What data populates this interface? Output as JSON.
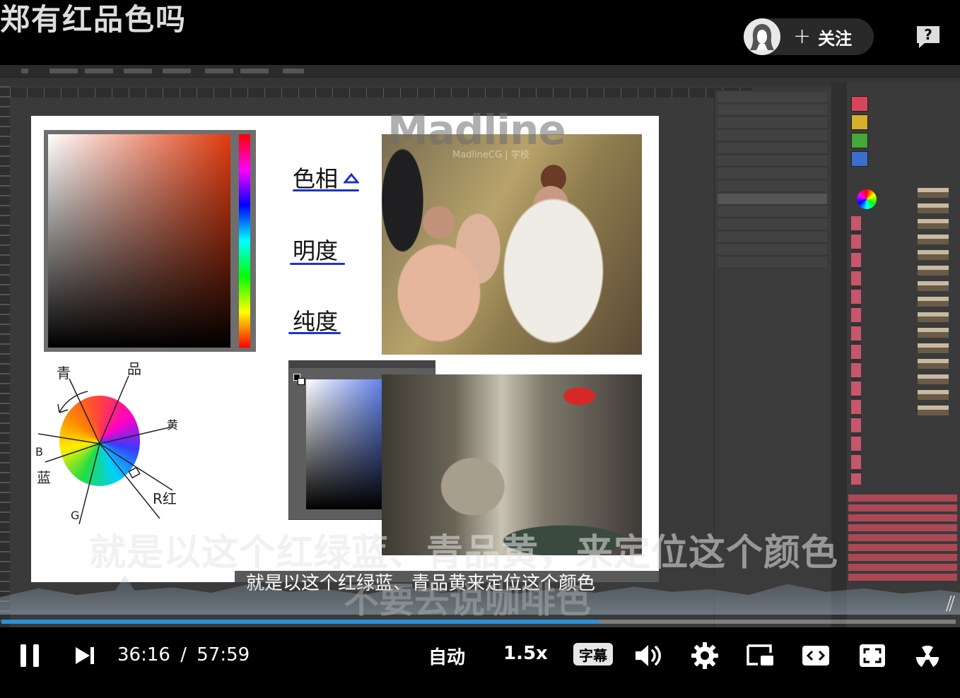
{
  "header": {
    "title": "郑有红品色吗",
    "follow_label": "关注",
    "follow_plus": "+"
  },
  "video": {
    "canvas": {
      "label_hue": "色相",
      "label_brightness": "明度",
      "label_saturation": "纯度",
      "logo": "Madline",
      "logo_sub": "MadlineCG | 学校",
      "wheel_labels": [
        "青",
        "品",
        "黄",
        "R红",
        "蓝",
        "B",
        "G"
      ]
    },
    "subtitle_small": "就是以这个红绿蓝、青品黄来定位这个颜色",
    "subtitle_big": "就是以这个红绿蓝、青品黄，来定位这个颜色",
    "subtitle_big2": "不要去说咖啡色"
  },
  "player": {
    "current_time": "36:16",
    "separator": "/",
    "duration": "57:59",
    "progress_fraction": 0.626,
    "auto_label": "自动",
    "speed_label": "1.5x",
    "subtitle_label": "字幕"
  },
  "colors": {
    "progress": "#2d8fd6",
    "accent_underline": "#1f33c8"
  }
}
